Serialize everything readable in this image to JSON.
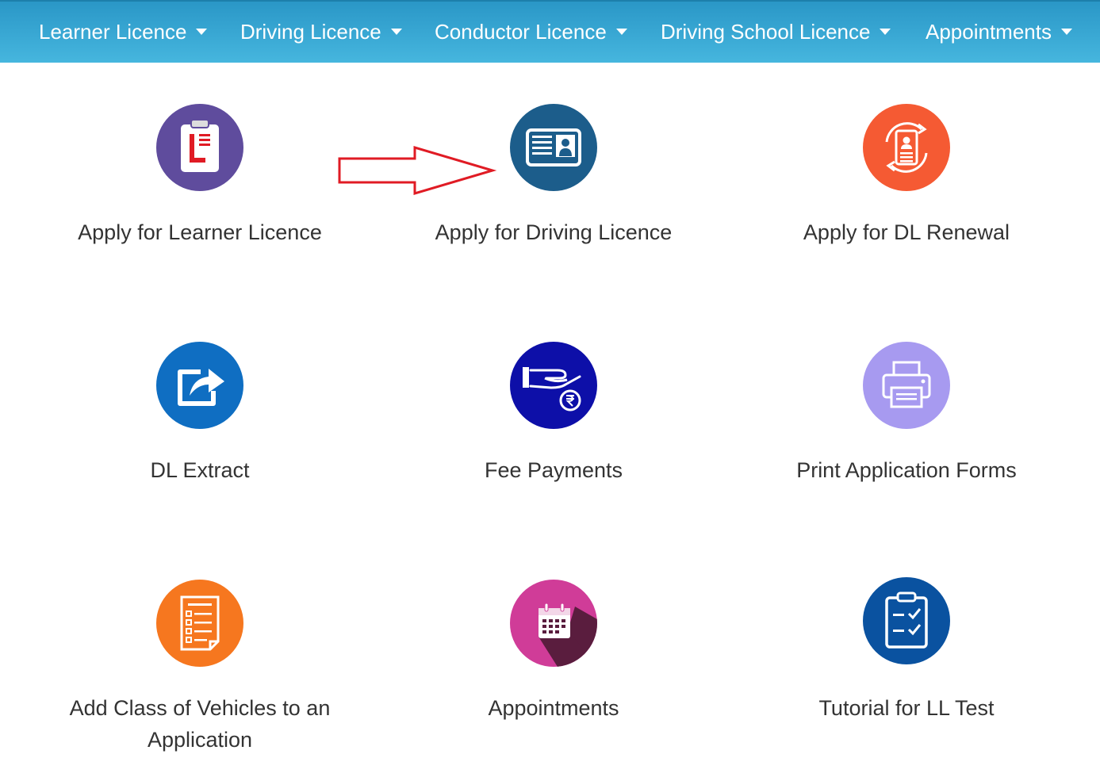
{
  "nav": {
    "items": [
      {
        "label": "Learner Licence"
      },
      {
        "label": "Driving Licence"
      },
      {
        "label": "Conductor Licence"
      },
      {
        "label": "Driving School Licence"
      },
      {
        "label": "Appointments"
      }
    ]
  },
  "tiles": [
    {
      "label": "Apply for Learner Licence",
      "icon": "learner-licence-clipboard-icon",
      "color": "#5f4c9d"
    },
    {
      "label": "Apply for Driving Licence",
      "icon": "id-card-icon",
      "color": "#1c5d8b"
    },
    {
      "label": "Apply for DL Renewal",
      "icon": "renewal-document-icon",
      "color": "#f55a33"
    },
    {
      "label": "DL Extract",
      "icon": "share-export-icon",
      "color": "#0f6ec2"
    },
    {
      "label": "Fee Payments",
      "icon": "hand-rupee-payment-icon",
      "color": "#0d0fa8"
    },
    {
      "label": "Print Application Forms",
      "icon": "printer-icon",
      "color": "#a79af0"
    },
    {
      "label": "Add Class of Vehicles to an Application",
      "icon": "form-list-icon",
      "color": "#f6771f"
    },
    {
      "label": "Appointments",
      "icon": "calendar-icon",
      "color": "#d03c98"
    },
    {
      "label": "Tutorial for LL Test",
      "icon": "checklist-clipboard-icon",
      "color": "#0a52a0"
    }
  ],
  "annotation": {
    "icon": "red-arrow-pointer-icon",
    "color": "#e01b24"
  }
}
